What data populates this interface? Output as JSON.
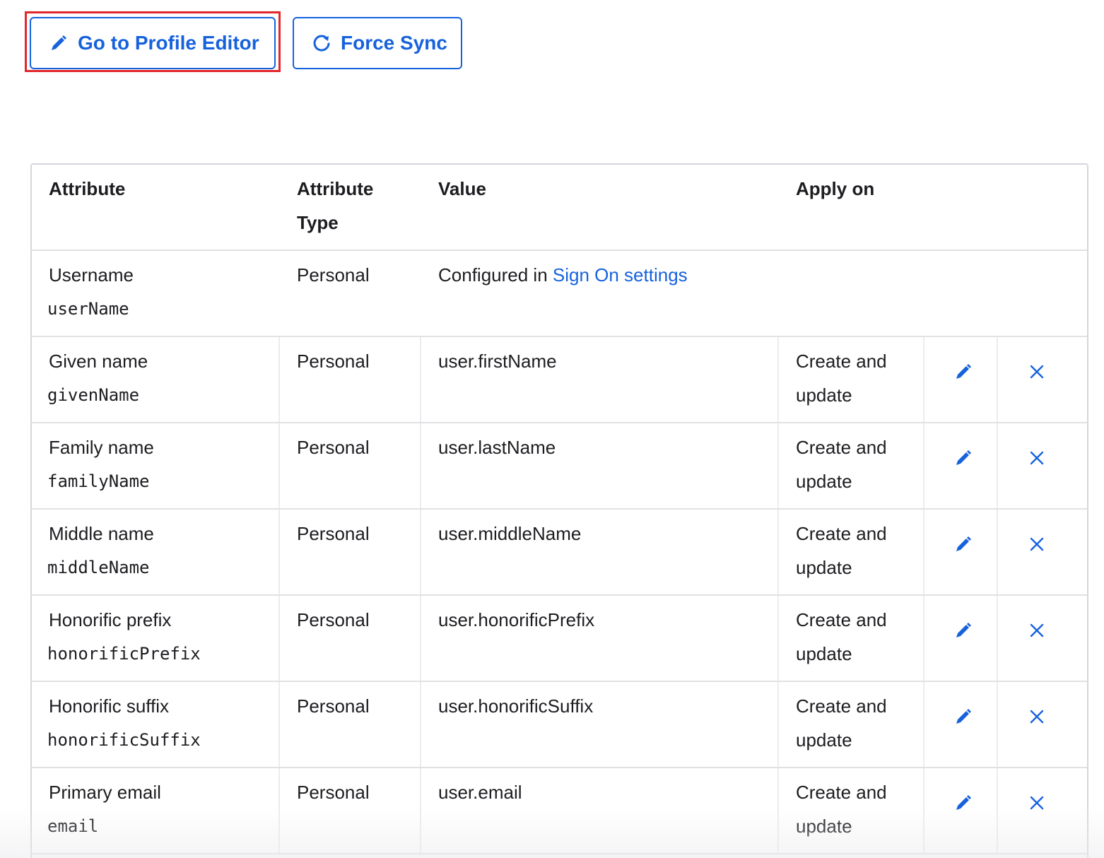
{
  "toolbar": {
    "editor_label": "Go to Profile Editor",
    "sync_label": "Force Sync"
  },
  "table": {
    "headers": {
      "attribute": "Attribute",
      "attribute_type_line1": "Attribute",
      "attribute_type_line2": "Type",
      "value": "Value",
      "apply_on": "Apply on"
    },
    "rows": [
      {
        "label": "Username",
        "key": "userName",
        "type": "Personal",
        "value_prefix": "Configured in ",
        "value_link": "Sign On settings"
      },
      {
        "label": "Given name",
        "key": "givenName",
        "type": "Personal",
        "value": "user.firstName",
        "apply_line1": "Create and",
        "apply_line2": "update"
      },
      {
        "label": "Family name",
        "key": "familyName",
        "type": "Personal",
        "value": "user.lastName",
        "apply_line1": "Create and",
        "apply_line2": "update"
      },
      {
        "label": "Middle name",
        "key": "middleName",
        "type": "Personal",
        "value": "user.middleName",
        "apply_line1": "Create and",
        "apply_line2": "update"
      },
      {
        "label": "Honorific prefix",
        "key": "honorificPrefix",
        "type": "Personal",
        "value": "user.honorificPrefix",
        "apply_line1": "Create and",
        "apply_line2": "update"
      },
      {
        "label": "Honorific suffix",
        "key": "honorificSuffix",
        "type": "Personal",
        "value": "user.honorificSuffix",
        "apply_line1": "Create and",
        "apply_line2": "update"
      },
      {
        "label": "Primary email",
        "key": "email",
        "type": "Personal",
        "value": "user.email",
        "apply_line1": "Create and",
        "apply_line2": "update"
      }
    ]
  },
  "icons": {
    "editor": "pencil-icon",
    "sync": "refresh-icon",
    "edit": "pencil-icon",
    "delete": "close-icon"
  },
  "colors": {
    "accent": "#1662dd",
    "highlight": "#e3262b",
    "border": "#d7d7dc"
  }
}
